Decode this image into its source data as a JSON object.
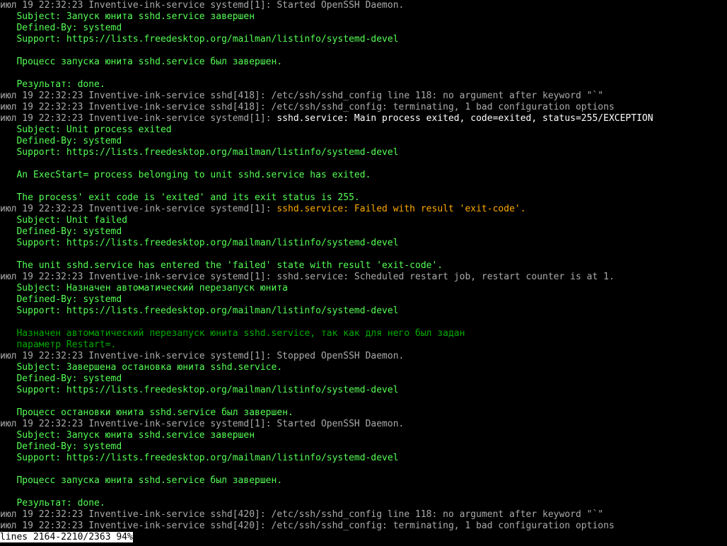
{
  "prefix": "июл 19 22:32:23 Inventive-ink-service ",
  "sshd418": "sshd[418]: ",
  "sshd420": "sshd[420]: ",
  "systemd1": "systemd[1]: ",
  "msg": {
    "started_openssh": "Started OpenSSH Daemon.",
    "stopped_openssh": "Stopped OpenSSH Daemon.",
    "subj_start_ru": "Subject: Запуск юнита sshd.service завершен",
    "subj_stop_ru": "Subject: Завершена остановка юнита sshd.service.",
    "subj_autorestart_ru": "Subject: Назначен автоматический перезапуск юнита",
    "subj_unit_exited": "Subject: Unit process exited",
    "subj_unit_failed": "Subject: Unit failed",
    "defined_by": "Defined-By: systemd",
    "support": "Support: https://lists.freedesktop.org/mailman/listinfo/systemd-devel",
    "proc_start_ru": "Процесс запуска юнита sshd.service был завершен.",
    "proc_stop_ru": "Процесс остановки юнита sshd.service был завершен.",
    "result_done": "Результат: done.",
    "cfg_line118": "/etc/ssh/sshd_config line 118: no argument after keyword \"`\"",
    "cfg_terminating": "/etc/ssh/sshd_config: terminating, 1 bad configuration options",
    "main_exited": "sshd.service: Main process exited, code=exited, status=255/EXCEPTION",
    "execstart_exited": "An ExecStart= process belonging to unit sshd.service has exited.",
    "exit_code_255": "The process' exit code is 'exited' and its exit status is 255.",
    "failed_exitcode": "sshd.service: Failed with result 'exit-code'.",
    "entered_failed": "The unit sshd.service has entered the 'failed' state with result 'exit-code'.",
    "scheduled_restart": "sshd.service: Scheduled restart job, restart counter is at 1.",
    "autorestart_line1": "Назначен автоматический перезапуск юнита sshd.service, так как для него был задан",
    "autorestart_line2": "параметр Restart=."
  },
  "pad": "   ",
  "status_line": "lines 2164-2210/2363 94%"
}
